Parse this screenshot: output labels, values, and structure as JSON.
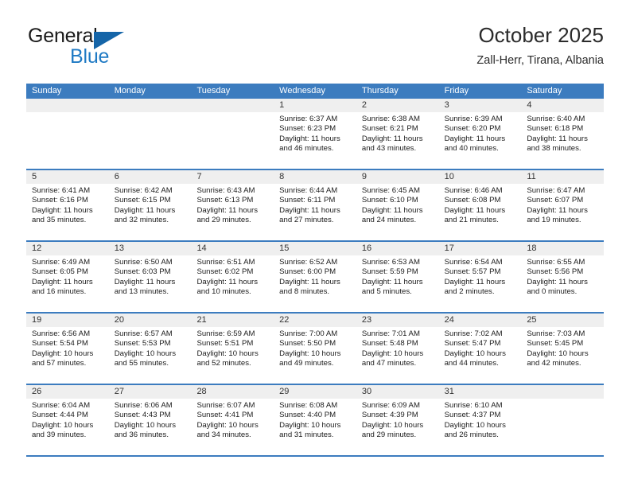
{
  "brand": {
    "name_part1": "General",
    "name_part2": "Blue",
    "logo_icon": "triangle-logo-icon"
  },
  "header": {
    "title": "October 2025",
    "subtitle": "Zall-Herr, Tirana, Albania"
  },
  "colors": {
    "header_blue": "#3c7cbf",
    "brand_blue": "#1f7ac4",
    "cell_head_gray": "#efefef"
  },
  "calendar": {
    "day_headers": [
      "Sunday",
      "Monday",
      "Tuesday",
      "Wednesday",
      "Thursday",
      "Friday",
      "Saturday"
    ],
    "weeks": [
      [
        {
          "day": "",
          "lines": []
        },
        {
          "day": "",
          "lines": []
        },
        {
          "day": "",
          "lines": []
        },
        {
          "day": "1",
          "lines": [
            "Sunrise: 6:37 AM",
            "Sunset: 6:23 PM",
            "Daylight: 11 hours",
            "and 46 minutes."
          ]
        },
        {
          "day": "2",
          "lines": [
            "Sunrise: 6:38 AM",
            "Sunset: 6:21 PM",
            "Daylight: 11 hours",
            "and 43 minutes."
          ]
        },
        {
          "day": "3",
          "lines": [
            "Sunrise: 6:39 AM",
            "Sunset: 6:20 PM",
            "Daylight: 11 hours",
            "and 40 minutes."
          ]
        },
        {
          "day": "4",
          "lines": [
            "Sunrise: 6:40 AM",
            "Sunset: 6:18 PM",
            "Daylight: 11 hours",
            "and 38 minutes."
          ]
        }
      ],
      [
        {
          "day": "5",
          "lines": [
            "Sunrise: 6:41 AM",
            "Sunset: 6:16 PM",
            "Daylight: 11 hours",
            "and 35 minutes."
          ]
        },
        {
          "day": "6",
          "lines": [
            "Sunrise: 6:42 AM",
            "Sunset: 6:15 PM",
            "Daylight: 11 hours",
            "and 32 minutes."
          ]
        },
        {
          "day": "7",
          "lines": [
            "Sunrise: 6:43 AM",
            "Sunset: 6:13 PM",
            "Daylight: 11 hours",
            "and 29 minutes."
          ]
        },
        {
          "day": "8",
          "lines": [
            "Sunrise: 6:44 AM",
            "Sunset: 6:11 PM",
            "Daylight: 11 hours",
            "and 27 minutes."
          ]
        },
        {
          "day": "9",
          "lines": [
            "Sunrise: 6:45 AM",
            "Sunset: 6:10 PM",
            "Daylight: 11 hours",
            "and 24 minutes."
          ]
        },
        {
          "day": "10",
          "lines": [
            "Sunrise: 6:46 AM",
            "Sunset: 6:08 PM",
            "Daylight: 11 hours",
            "and 21 minutes."
          ]
        },
        {
          "day": "11",
          "lines": [
            "Sunrise: 6:47 AM",
            "Sunset: 6:07 PM",
            "Daylight: 11 hours",
            "and 19 minutes."
          ]
        }
      ],
      [
        {
          "day": "12",
          "lines": [
            "Sunrise: 6:49 AM",
            "Sunset: 6:05 PM",
            "Daylight: 11 hours",
            "and 16 minutes."
          ]
        },
        {
          "day": "13",
          "lines": [
            "Sunrise: 6:50 AM",
            "Sunset: 6:03 PM",
            "Daylight: 11 hours",
            "and 13 minutes."
          ]
        },
        {
          "day": "14",
          "lines": [
            "Sunrise: 6:51 AM",
            "Sunset: 6:02 PM",
            "Daylight: 11 hours",
            "and 10 minutes."
          ]
        },
        {
          "day": "15",
          "lines": [
            "Sunrise: 6:52 AM",
            "Sunset: 6:00 PM",
            "Daylight: 11 hours",
            "and 8 minutes."
          ]
        },
        {
          "day": "16",
          "lines": [
            "Sunrise: 6:53 AM",
            "Sunset: 5:59 PM",
            "Daylight: 11 hours",
            "and 5 minutes."
          ]
        },
        {
          "day": "17",
          "lines": [
            "Sunrise: 6:54 AM",
            "Sunset: 5:57 PM",
            "Daylight: 11 hours",
            "and 2 minutes."
          ]
        },
        {
          "day": "18",
          "lines": [
            "Sunrise: 6:55 AM",
            "Sunset: 5:56 PM",
            "Daylight: 11 hours",
            "and 0 minutes."
          ]
        }
      ],
      [
        {
          "day": "19",
          "lines": [
            "Sunrise: 6:56 AM",
            "Sunset: 5:54 PM",
            "Daylight: 10 hours",
            "and 57 minutes."
          ]
        },
        {
          "day": "20",
          "lines": [
            "Sunrise: 6:57 AM",
            "Sunset: 5:53 PM",
            "Daylight: 10 hours",
            "and 55 minutes."
          ]
        },
        {
          "day": "21",
          "lines": [
            "Sunrise: 6:59 AM",
            "Sunset: 5:51 PM",
            "Daylight: 10 hours",
            "and 52 minutes."
          ]
        },
        {
          "day": "22",
          "lines": [
            "Sunrise: 7:00 AM",
            "Sunset: 5:50 PM",
            "Daylight: 10 hours",
            "and 49 minutes."
          ]
        },
        {
          "day": "23",
          "lines": [
            "Sunrise: 7:01 AM",
            "Sunset: 5:48 PM",
            "Daylight: 10 hours",
            "and 47 minutes."
          ]
        },
        {
          "day": "24",
          "lines": [
            "Sunrise: 7:02 AM",
            "Sunset: 5:47 PM",
            "Daylight: 10 hours",
            "and 44 minutes."
          ]
        },
        {
          "day": "25",
          "lines": [
            "Sunrise: 7:03 AM",
            "Sunset: 5:45 PM",
            "Daylight: 10 hours",
            "and 42 minutes."
          ]
        }
      ],
      [
        {
          "day": "26",
          "lines": [
            "Sunrise: 6:04 AM",
            "Sunset: 4:44 PM",
            "Daylight: 10 hours",
            "and 39 minutes."
          ]
        },
        {
          "day": "27",
          "lines": [
            "Sunrise: 6:06 AM",
            "Sunset: 4:43 PM",
            "Daylight: 10 hours",
            "and 36 minutes."
          ]
        },
        {
          "day": "28",
          "lines": [
            "Sunrise: 6:07 AM",
            "Sunset: 4:41 PM",
            "Daylight: 10 hours",
            "and 34 minutes."
          ]
        },
        {
          "day": "29",
          "lines": [
            "Sunrise: 6:08 AM",
            "Sunset: 4:40 PM",
            "Daylight: 10 hours",
            "and 31 minutes."
          ]
        },
        {
          "day": "30",
          "lines": [
            "Sunrise: 6:09 AM",
            "Sunset: 4:39 PM",
            "Daylight: 10 hours",
            "and 29 minutes."
          ]
        },
        {
          "day": "31",
          "lines": [
            "Sunrise: 6:10 AM",
            "Sunset: 4:37 PM",
            "Daylight: 10 hours",
            "and 26 minutes."
          ]
        },
        {
          "day": "",
          "lines": []
        }
      ]
    ]
  }
}
